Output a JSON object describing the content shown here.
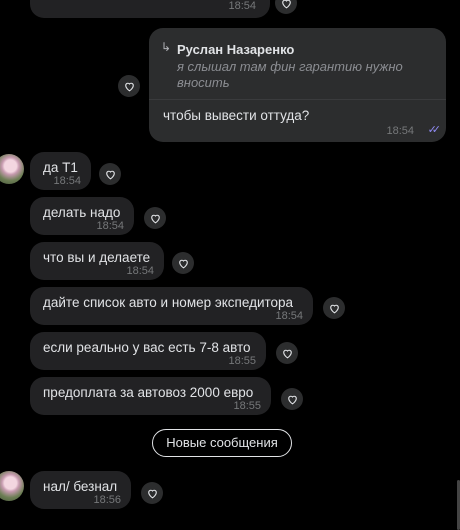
{
  "top_message": {
    "time": "18:54"
  },
  "out_message": {
    "reply_name": "Руслан Назаренко",
    "reply_text": "я слышал там фин гарантию нужно вносить",
    "text": "чтобы вывести оттуда?",
    "time": "18:54",
    "check": "✓✓"
  },
  "messages": [
    {
      "text": "да Т1",
      "time": "18:54"
    },
    {
      "text": "делать надо",
      "time": "18:54"
    },
    {
      "text": "что вы и делаете",
      "time": "18:54"
    },
    {
      "text": "дайте список авто и номер экспедитора",
      "time": "18:54"
    },
    {
      "text": "если реально у вас есть 7-8 авто",
      "time": "18:55"
    },
    {
      "text": "предоплата за автовоз 2000 евро",
      "time": "18:55"
    }
  ],
  "new_messages_label": "Новые сообщения",
  "last_message": {
    "text": "нал/ безнал",
    "time": "18:56"
  },
  "colors": {
    "accent": "#8f8af2",
    "bubble_in": "#222224",
    "bubble_out": "#2c2d2e"
  }
}
